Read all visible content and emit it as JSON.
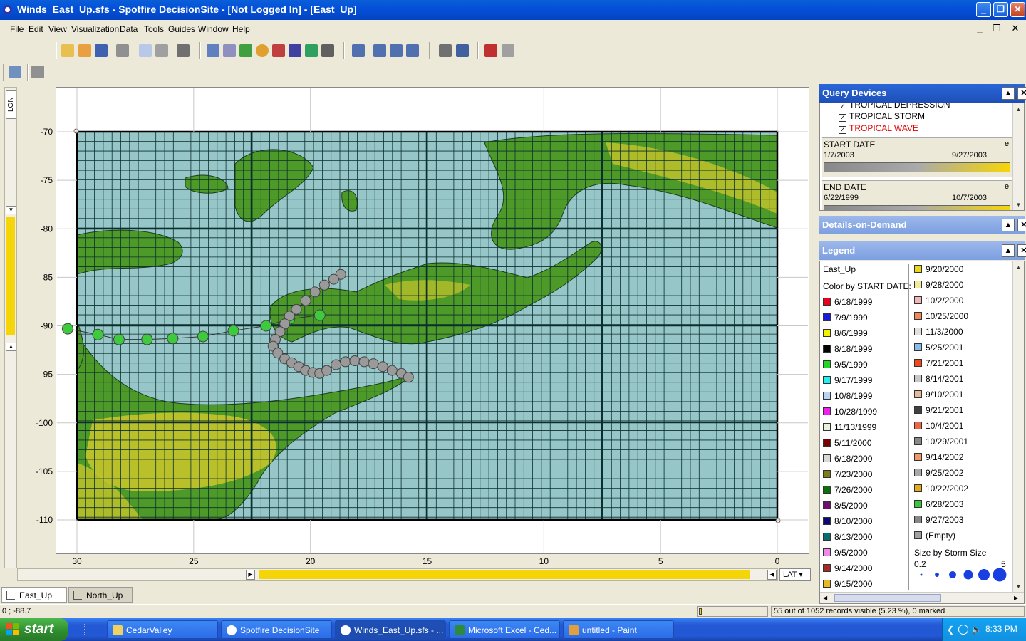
{
  "window": {
    "title": "Winds_East_Up.sfs - Spotfire DecisionSite - [Not Logged In] - [East_Up]"
  },
  "menu": {
    "items": [
      "File",
      "Edit",
      "View",
      "Visualization",
      "Data",
      "Tools",
      "Guides",
      "Window",
      "Help"
    ]
  },
  "plot": {
    "vslider_label": "LON",
    "hslider_label": "LAT",
    "y_ticks": [
      "-70",
      "-75",
      "-80",
      "-85",
      "-90",
      "-95",
      "-100",
      "-105",
      "-110"
    ],
    "x_ticks": [
      "30",
      "25",
      "20",
      "15",
      "10",
      "5",
      "0"
    ],
    "colors": {
      "land": "#4E9A28",
      "highland": "#C7C42A",
      "sea": "#97C6C8",
      "grid": "#0B2F2F",
      "series_green": "#3DCB3D",
      "series_gray": "#9A9A9A"
    }
  },
  "chart_data": {
    "type": "scatter",
    "xlim": [
      30,
      0
    ],
    "ylim": [
      -70,
      -110
    ],
    "series": [
      {
        "color": "#3DCB3D",
        "points": [
          [
            30.4,
            -90.3
          ],
          [
            29.1,
            -90.9
          ],
          [
            28.2,
            -91.4
          ],
          [
            27.0,
            -91.4
          ],
          [
            25.9,
            -91.3
          ],
          [
            24.6,
            -91.1
          ],
          [
            23.3,
            -90.5
          ],
          [
            21.9,
            -90.0
          ],
          [
            20.9,
            -89.3
          ],
          [
            19.6,
            -88.9
          ]
        ]
      },
      {
        "color": "#9A9A9A",
        "points": [
          [
            18.7,
            -84.7
          ],
          [
            19.0,
            -85.2
          ],
          [
            19.4,
            -85.8
          ],
          [
            19.8,
            -86.5
          ],
          [
            20.2,
            -87.4
          ],
          [
            20.6,
            -88.3
          ],
          [
            20.9,
            -89.0
          ],
          [
            21.1,
            -89.8
          ],
          [
            21.3,
            -90.6
          ],
          [
            21.5,
            -91.4
          ],
          [
            21.6,
            -92.1
          ],
          [
            21.4,
            -92.8
          ],
          [
            21.1,
            -93.4
          ],
          [
            20.8,
            -93.8
          ],
          [
            20.5,
            -94.2
          ],
          [
            20.2,
            -94.6
          ],
          [
            19.9,
            -94.8
          ],
          [
            19.6,
            -94.9
          ],
          [
            19.3,
            -94.6
          ],
          [
            18.9,
            -94.0
          ],
          [
            18.5,
            -93.7
          ],
          [
            18.1,
            -93.6
          ],
          [
            17.7,
            -93.7
          ],
          [
            17.3,
            -93.9
          ],
          [
            16.9,
            -94.2
          ],
          [
            16.5,
            -94.6
          ],
          [
            16.1,
            -94.9
          ],
          [
            15.8,
            -95.3
          ]
        ]
      }
    ]
  },
  "tabs": [
    "East_Up",
    "North_Up"
  ],
  "status": {
    "coords": "0 ; -88.7",
    "records": "55 out of 1052 records visible (5.23 %), 0 marked"
  },
  "query_devices": {
    "title": "Query Devices",
    "partial_item": "TROPICAL DEPRESSION",
    "checkboxes": [
      {
        "label": "TROPICAL STORM",
        "color": "#000000"
      },
      {
        "label": "TROPICAL WAVE",
        "color": "#E00000"
      }
    ],
    "start_date": {
      "label": "START DATE",
      "min": "1/7/2003",
      "max": "9/27/2003",
      "corner": "e"
    },
    "end_date": {
      "label": "END DATE",
      "min": "6/22/1999",
      "max": "10/7/2003",
      "corner": "e"
    }
  },
  "details": {
    "title": "Details-on-Demand"
  },
  "legend": {
    "title": "Legend",
    "view_name": "East_Up",
    "color_by": "Color by START DATE:",
    "col1": [
      {
        "label": "6/18/1999",
        "color": "#E8001C"
      },
      {
        "label": "7/9/1999",
        "color": "#1A1AE6"
      },
      {
        "label": "8/6/1999",
        "color": "#F2F200"
      },
      {
        "label": "8/18/1999",
        "color": "#000000"
      },
      {
        "label": "9/5/1999",
        "color": "#22D822"
      },
      {
        "label": "9/17/1999",
        "color": "#20F0F0"
      },
      {
        "label": "10/8/1999",
        "color": "#B8D6F2"
      },
      {
        "label": "10/28/1999",
        "color": "#F01CF0"
      },
      {
        "label": "11/13/1999",
        "color": "#E8F2D8"
      },
      {
        "label": "5/11/2000",
        "color": "#780000"
      },
      {
        "label": "6/18/2000",
        "color": "#D8D8D8"
      },
      {
        "label": "7/23/2000",
        "color": "#7C7C18"
      },
      {
        "label": "7/26/2000",
        "color": "#0E6E0E"
      },
      {
        "label": "8/5/2000",
        "color": "#6E0E6E"
      },
      {
        "label": "8/10/2000",
        "color": "#0A0A6E"
      },
      {
        "label": "8/13/2000",
        "color": "#0A6E6E"
      },
      {
        "label": "9/5/2000",
        "color": "#F08AE8"
      },
      {
        "label": "9/14/2000",
        "color": "#A82828"
      },
      {
        "label": "9/15/2000",
        "color": "#E8B828"
      }
    ],
    "col2": [
      {
        "label": "9/20/2000",
        "color": "#E8D818"
      },
      {
        "label": "9/28/2000",
        "color": "#F2EC9A"
      },
      {
        "label": "10/2/2000",
        "color": "#F2B8B8"
      },
      {
        "label": "10/25/2000",
        "color": "#F08858"
      },
      {
        "label": "11/3/2000",
        "color": "#E6E0DC"
      },
      {
        "label": "5/25/2001",
        "color": "#8ABCE8"
      },
      {
        "label": "7/21/2001",
        "color": "#F04818"
      },
      {
        "label": "8/14/2001",
        "color": "#C8C8C8"
      },
      {
        "label": "9/10/2001",
        "color": "#E8B898"
      },
      {
        "label": "9/21/2001",
        "color": "#404040"
      },
      {
        "label": "10/4/2001",
        "color": "#E86848"
      },
      {
        "label": "10/29/2001",
        "color": "#888888"
      },
      {
        "label": "9/14/2002",
        "color": "#F09868"
      },
      {
        "label": "9/25/2002",
        "color": "#A8A8A8"
      },
      {
        "label": "10/22/2002",
        "color": "#E8A818"
      },
      {
        "label": "6/28/2003",
        "color": "#38C838"
      },
      {
        "label": "9/27/2003",
        "color": "#888888"
      },
      {
        "label": "(Empty)",
        "color": "#A0A0A0"
      }
    ],
    "size_by": "Size by Storm Size",
    "size_min": "0.2",
    "size_max": "5"
  },
  "taskbar": {
    "start": "start",
    "buttons": [
      "CedarValley",
      "Spotfire DecisionSite",
      "Winds_East_Up.sfs - ...",
      "Microsoft Excel - Ced...",
      "untitled - Paint"
    ],
    "clock": "8:33 PM"
  }
}
